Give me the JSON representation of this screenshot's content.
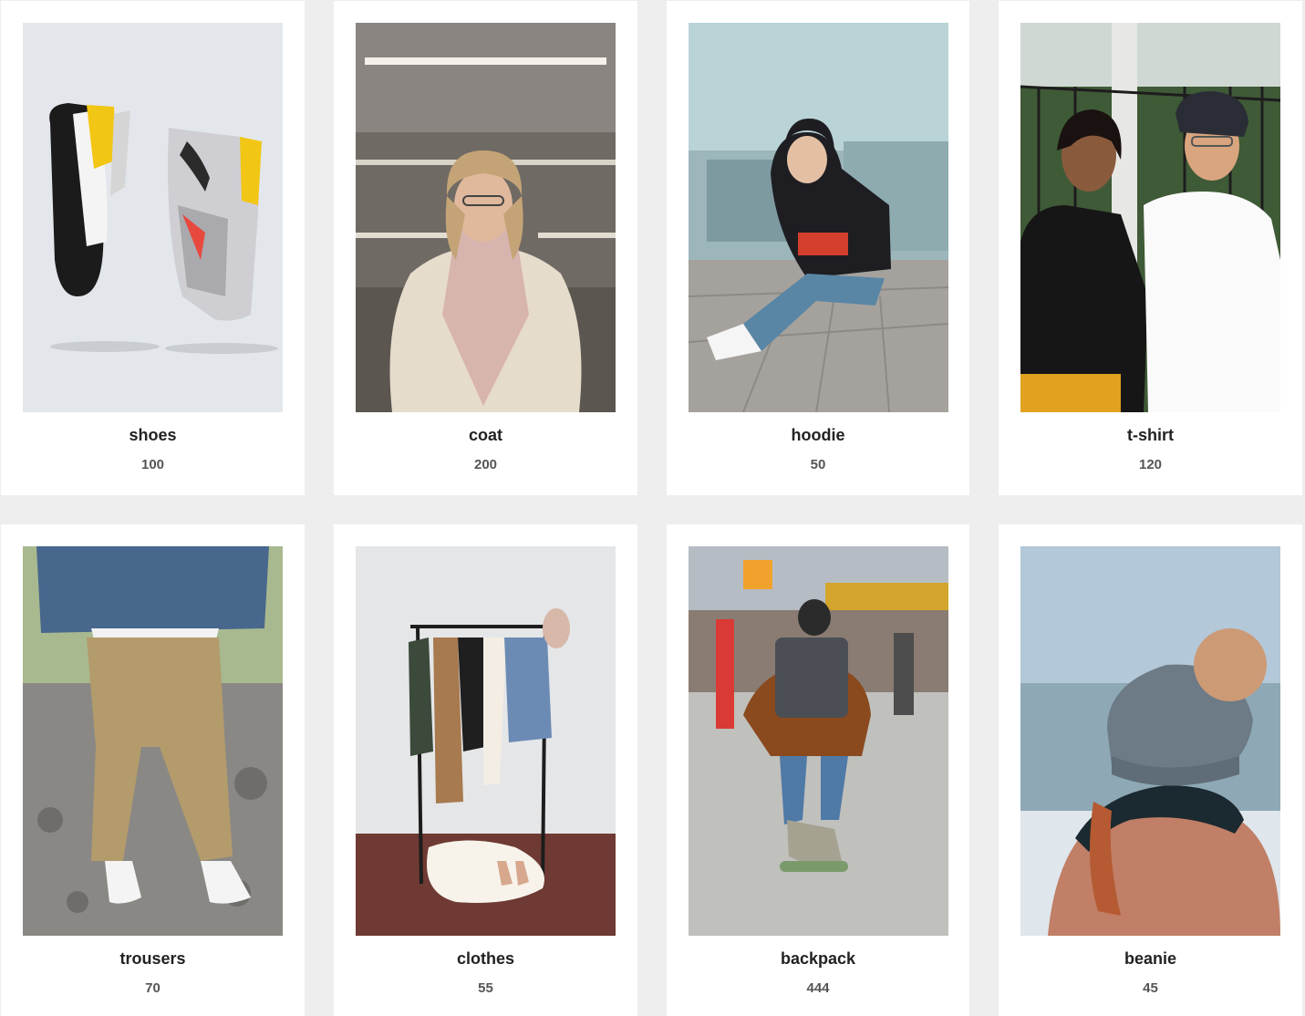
{
  "products": [
    {
      "name": "shoes",
      "price": "100",
      "image": "shoes-photo"
    },
    {
      "name": "coat",
      "price": "200",
      "image": "coat-photo"
    },
    {
      "name": "hoodie",
      "price": "50",
      "image": "hoodie-photo"
    },
    {
      "name": "t-shirt",
      "price": "120",
      "image": "tshirt-photo"
    },
    {
      "name": "trousers",
      "price": "70",
      "image": "trousers-photo"
    },
    {
      "name": "clothes",
      "price": "55",
      "image": "clothes-photo"
    },
    {
      "name": "backpack",
      "price": "444",
      "image": "backpack-photo"
    },
    {
      "name": "beanie",
      "price": "45",
      "image": "beanie-photo"
    }
  ],
  "colors": {
    "page_background": "#eeeeee",
    "card_background": "#ffffff",
    "title_text": "#222222",
    "price_text": "#555555"
  }
}
